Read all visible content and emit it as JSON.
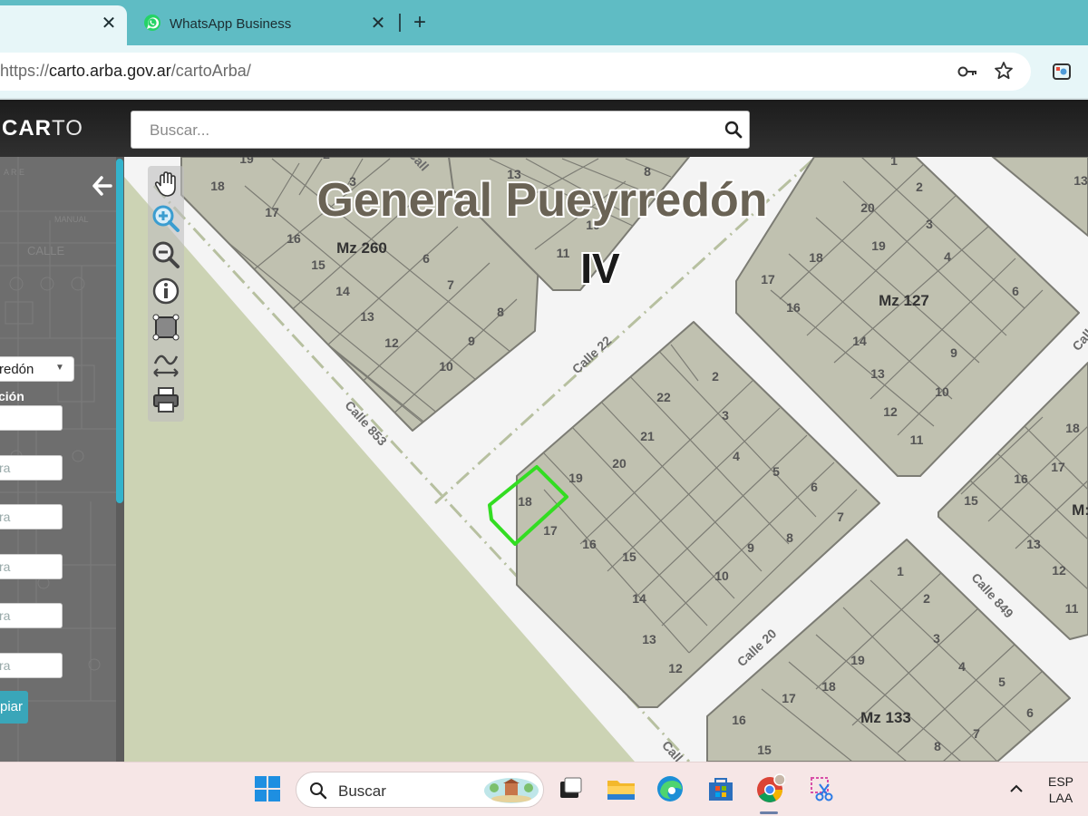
{
  "browser": {
    "tabs": [
      {
        "label": "",
        "active": true
      },
      {
        "label": "WhatsApp Business",
        "active": false
      }
    ],
    "close_glyph": "✕",
    "new_tab_glyph": "+",
    "url_prefix": "https://",
    "url_host": "carto.arba.gov.ar",
    "url_path": "/cartoArba/"
  },
  "app": {
    "logo_bold": "CAR",
    "logo_thin": "TO",
    "search_placeholder": "Buscar..."
  },
  "sidebar": {
    "partido_value": "redón",
    "caret": "▼",
    "label": "ción",
    "inputs": [
      "",
      "ra",
      "ra",
      "ra",
      "ra",
      "ra"
    ],
    "clear_button": "piar"
  },
  "map": {
    "title": "General Pueyrredón",
    "circ": "IV",
    "manzanas": [
      "Mz 260",
      "Mz 127",
      "Mz 133",
      "M:"
    ],
    "streets": [
      "Calle 22",
      "Calle 853",
      "Calle 20",
      "Calle 849",
      "Call",
      "Call",
      "Calle"
    ],
    "selected_parcel": "18"
  },
  "taskbar": {
    "search_label": "Buscar",
    "lang_1": "ESP",
    "lang_2": "LAA"
  },
  "colors": {
    "tabbar": "#5fbcc4",
    "map_block": "#c0c1b0",
    "selection": "#33dd22",
    "accent": "#34b3cc"
  }
}
